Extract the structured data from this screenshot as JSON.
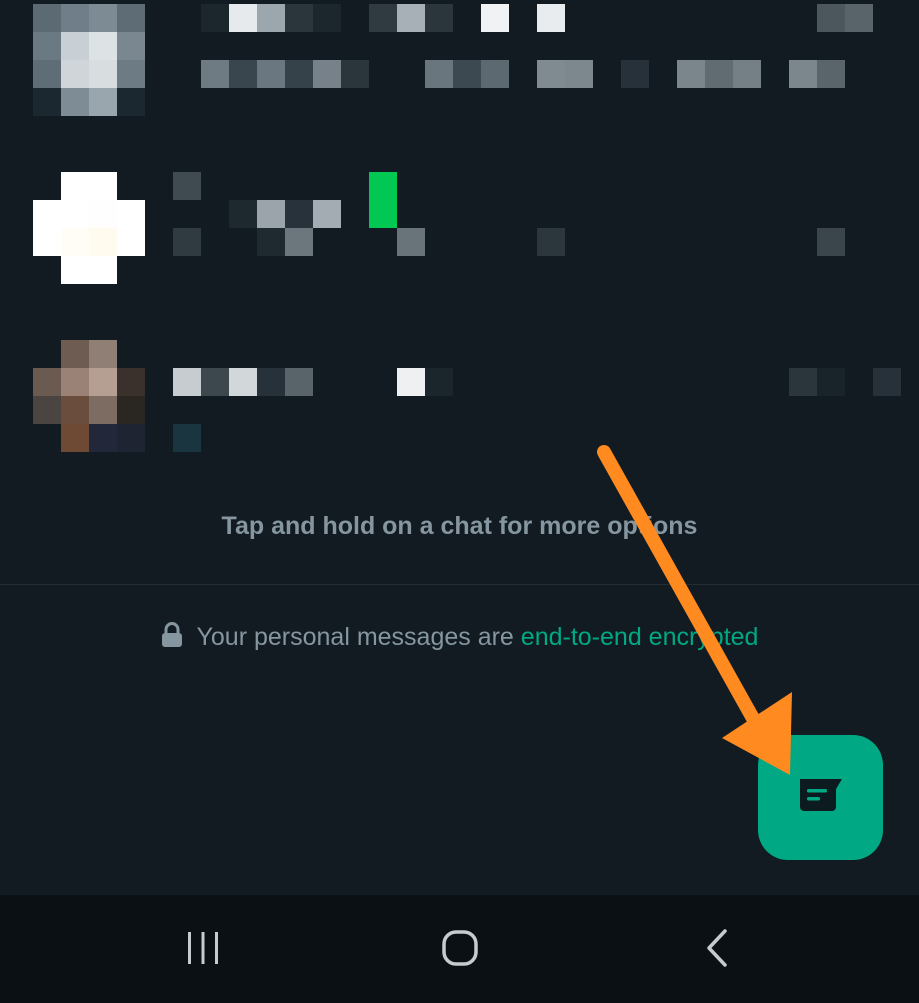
{
  "hint_text": "Tap and hold on a chat for more options",
  "encryption": {
    "text": "Your personal messages are ",
    "link": "end-to-end encrypted"
  },
  "fab": {
    "icon": "new-chat-icon",
    "color": "#00a884"
  },
  "annotation": {
    "arrow_color": "#ff8a1f"
  },
  "navbar": {
    "icons": [
      "recents-icon",
      "home-icon",
      "back-icon"
    ]
  },
  "colors": {
    "background": "#111b21",
    "accent": "#00a884",
    "secondary_text": "#8696a0"
  }
}
